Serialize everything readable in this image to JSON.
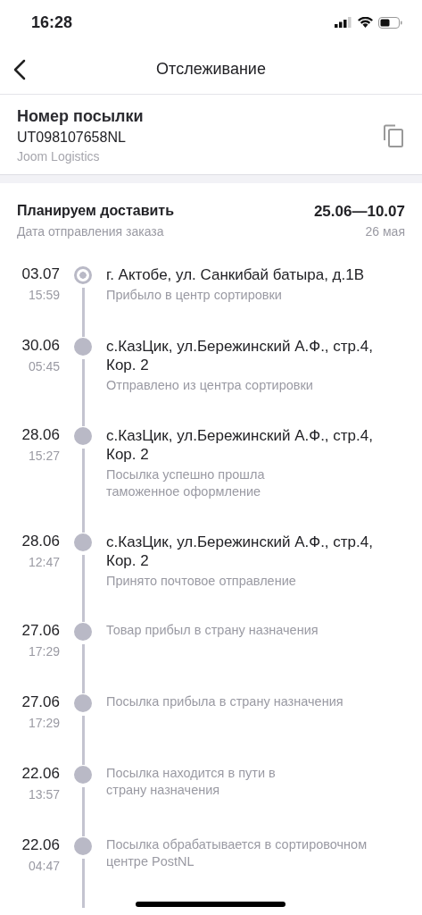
{
  "status_bar": {
    "time": "16:28"
  },
  "header": {
    "title": "Отслеживание"
  },
  "parcel": {
    "label": "Номер посылки",
    "number": "UT098107658NL",
    "carrier": "Joom Logistics"
  },
  "summary": {
    "planned_label": "Планируем доставить",
    "planned_range": "25.06—10.07",
    "sent_label": "Дата отправления заказа",
    "sent_date": "26 мая"
  },
  "events": [
    {
      "date": "03.07",
      "time": "15:59",
      "current": true,
      "address": "г. Актобе, ул. Санкибай батыра, д.1В",
      "status": "Прибыло в центр сортировки"
    },
    {
      "date": "30.06",
      "time": "05:45",
      "current": false,
      "address": "с.КазЦик, ул.Бережинский А.Ф., стр.4, Кор. 2",
      "status": "Отправлено из центра сортировки"
    },
    {
      "date": "28.06",
      "time": "15:27",
      "current": false,
      "address": "с.КазЦик, ул.Бережинский А.Ф., стр.4, Кор. 2",
      "status": "Посылка успешно прошла\nтаможенное оформление"
    },
    {
      "date": "28.06",
      "time": "12:47",
      "current": false,
      "address": "с.КазЦик, ул.Бережинский А.Ф., стр.4, Кор. 2",
      "status": "Принято почтовое отправление"
    },
    {
      "date": "27.06",
      "time": "17:29",
      "current": false,
      "status": "Товар прибыл в страну назначения"
    },
    {
      "date": "27.06",
      "time": "17:29",
      "current": false,
      "status": "Посылка прибыла в страну назначения"
    },
    {
      "date": "22.06",
      "time": "13:57",
      "current": false,
      "status": "Посылка находится в пути в\nстрану назначения"
    },
    {
      "date": "22.06",
      "time": "04:47",
      "current": false,
      "status": "Посылка обрабатывается в сортировочном\nцентре PostNL"
    }
  ]
}
